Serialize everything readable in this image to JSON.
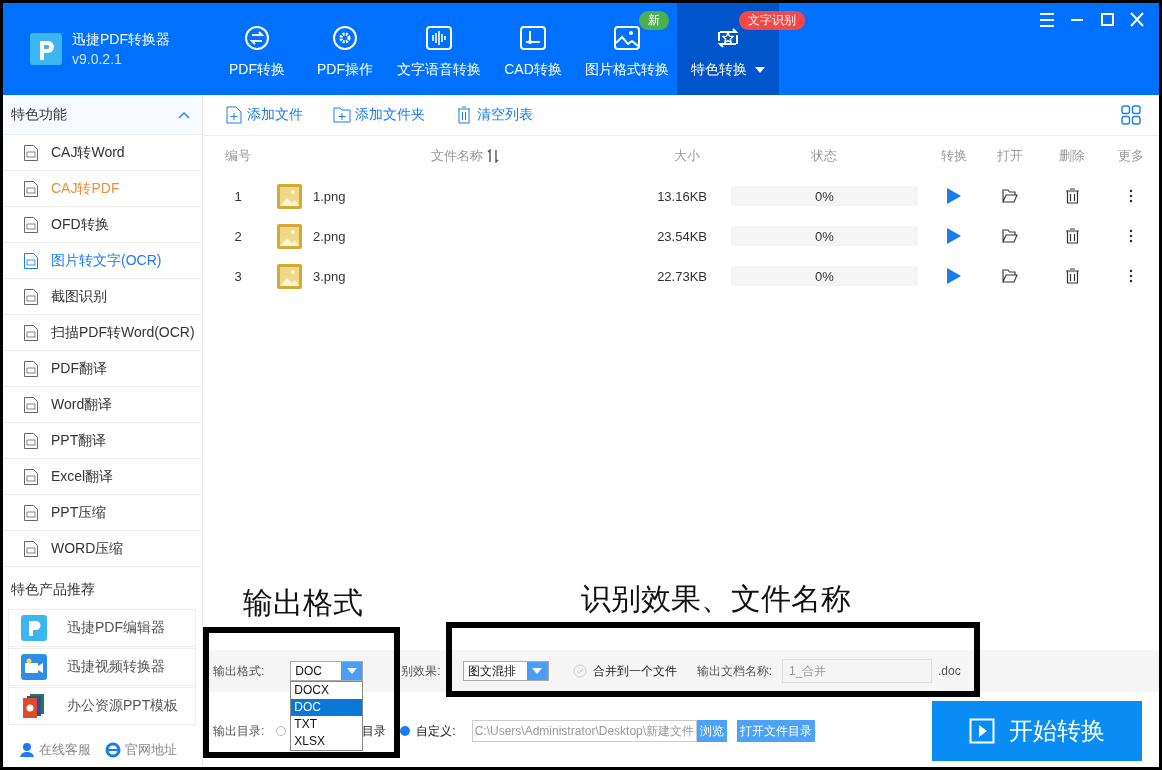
{
  "app": {
    "name": "迅捷PDF转换器",
    "version": "v9.0.2.1"
  },
  "nav": [
    {
      "label": "PDF转换",
      "selected": false
    },
    {
      "label": "PDF操作",
      "selected": false
    },
    {
      "label": "文字语音转换",
      "selected": false
    },
    {
      "label": "CAD转换",
      "selected": false
    },
    {
      "label": "图片格式转换",
      "selected": false,
      "badge": {
        "text": "新",
        "color": "#4caf50"
      }
    },
    {
      "label": "特色转换",
      "selected": true,
      "badge": {
        "text": "文字识别",
        "color": "#f44848"
      }
    }
  ],
  "sidebar": {
    "title": "特色功能",
    "expanded": true,
    "items": [
      {
        "label": "CAJ转Word",
        "selected": false,
        "hovered": false
      },
      {
        "label": "CAJ转PDF",
        "selected": false,
        "hovered": true
      },
      {
        "label": "OFD转换",
        "selected": false,
        "hovered": false
      },
      {
        "label": "图片转文字(OCR)",
        "selected": true,
        "hovered": false
      },
      {
        "label": "截图识别",
        "selected": false,
        "hovered": false
      },
      {
        "label": "扫描PDF转Word(OCR)",
        "selected": false,
        "hovered": false
      },
      {
        "label": "PDF翻译",
        "selected": false,
        "hovered": false
      },
      {
        "label": "Word翻译",
        "selected": false,
        "hovered": false
      },
      {
        "label": "PPT翻译",
        "selected": false,
        "hovered": false
      },
      {
        "label": "Excel翻译",
        "selected": false,
        "hovered": false
      },
      {
        "label": "PPT压缩",
        "selected": false,
        "hovered": false
      },
      {
        "label": "WORD压缩",
        "selected": false,
        "hovered": false
      }
    ],
    "products_title": "特色产品推荐",
    "products": [
      "迅捷PDF编辑器",
      "迅捷视频转换器",
      "办公资源PPT模板"
    ],
    "footer": [
      "在线客服",
      "官网地址"
    ]
  },
  "toolbar": [
    "添加文件",
    "添加文件夹",
    "清空列表"
  ],
  "table": {
    "columns": [
      "编号",
      "文件名称",
      "大小",
      "状态",
      "转换",
      "打开",
      "删除",
      "更多"
    ],
    "rows": [
      {
        "index": "1",
        "name": "1.png",
        "size": "13.16KB",
        "status": "0%",
        "level": 0
      },
      {
        "index": "2",
        "name": "2.png",
        "size": "23.54KB",
        "status": "0%",
        "level": 0
      },
      {
        "index": "3",
        "name": "3.png",
        "size": "22.73KB",
        "status": "0%",
        "level": 0
      }
    ]
  },
  "settings": {
    "format_label": "输出格式:",
    "format_value": "DOC",
    "format_options": [
      {
        "label": "DOCX",
        "selected": false
      },
      {
        "label": "DOC",
        "selected": true
      },
      {
        "label": "TXT",
        "selected": false
      },
      {
        "label": "XLSX",
        "selected": false
      }
    ],
    "effect_label": "别效果:",
    "effect_value": "图文混排",
    "merge": {
      "label": "合并到一个文件",
      "checked": false
    },
    "name_label": "输出文档名称:",
    "name_value": "1_合并",
    "extension": ".doc",
    "dir_label": "输出目录:",
    "dir_options": [
      {
        "label": "目录",
        "selected": false
      },
      {
        "label": "自定义:",
        "selected": true
      }
    ],
    "path": "C:\\Users\\Administrator\\Desktop\\新建文件",
    "browse": "浏览",
    "open_dir": "打开文件目录",
    "start": "开始转换"
  },
  "annotations": [
    {
      "label": "输出格式"
    },
    {
      "label": "识别效果、文件名称"
    }
  ]
}
